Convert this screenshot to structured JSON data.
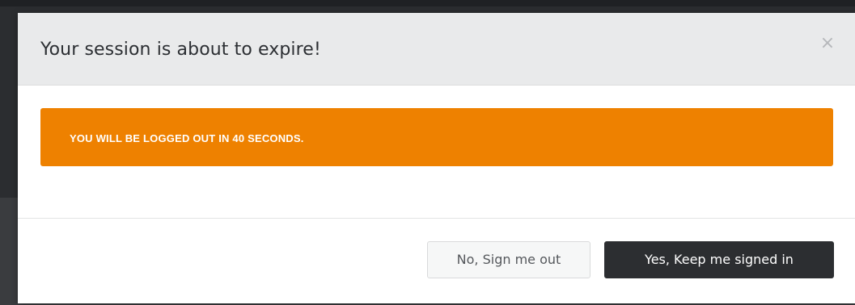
{
  "modal": {
    "title": "Your session is about to expire!",
    "close_glyph": "×",
    "alert_message": "YOU WILL BE LOGGED OUT IN 40 SECONDS.",
    "sign_out_label": "No, Sign me out",
    "keep_signed_in_label": "Yes, Keep me signed in"
  },
  "colors": {
    "alert_background": "#ee8100",
    "primary_button": "#2c2e31",
    "header_background": "#e9eaeb"
  },
  "icons": {
    "close": "close-icon"
  }
}
